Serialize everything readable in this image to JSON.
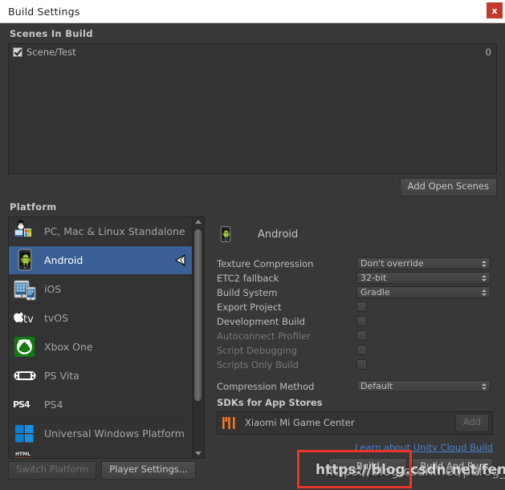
{
  "window": {
    "title": "Build Settings",
    "close_label": "x"
  },
  "scenes_section": {
    "header": "Scenes In Build",
    "rows": [
      {
        "name": "Scene/Test",
        "index": "0",
        "checked": true
      }
    ],
    "add_open_scenes_label": "Add Open Scenes"
  },
  "platform_section": {
    "header": "Platform",
    "items": [
      {
        "label": "PC, Mac & Linux Standalone",
        "icon": "standalone-icon",
        "selected": false
      },
      {
        "label": "Android",
        "icon": "android-icon",
        "selected": true
      },
      {
        "label": "iOS",
        "icon": "ios-icon",
        "selected": false
      },
      {
        "label": "tvOS",
        "icon": "tvos-icon",
        "selected": false
      },
      {
        "label": "Xbox One",
        "icon": "xbox-icon",
        "selected": false
      },
      {
        "label": "PS Vita",
        "icon": "psvita-icon",
        "selected": false
      },
      {
        "label": "PS4",
        "icon": "ps4-icon",
        "selected": false
      },
      {
        "label": "Universal Windows Platform",
        "icon": "windows-icon",
        "selected": false
      },
      {
        "label": "",
        "icon": "webgl-icon",
        "selected": false
      }
    ]
  },
  "settings_panel": {
    "platform_title": "Android",
    "dropdowns": [
      {
        "label": "Texture Compression",
        "value": "Don't override"
      },
      {
        "label": "ETC2 fallback",
        "value": "32-bit"
      },
      {
        "label": "Build System",
        "value": "Gradle"
      }
    ],
    "checkboxes": [
      {
        "label": "Export Project",
        "checked": false,
        "disabled": false
      },
      {
        "label": "Development Build",
        "checked": false,
        "disabled": false
      },
      {
        "label": "Autoconnect Profiler",
        "checked": false,
        "disabled": true
      },
      {
        "label": "Script Debugging",
        "checked": false,
        "disabled": true
      },
      {
        "label": "Scripts Only Build",
        "checked": false,
        "disabled": true
      }
    ],
    "compression": {
      "label": "Compression Method",
      "value": "Default"
    },
    "sdk_header": "SDKs for App Stores",
    "sdk_row": {
      "name": "Xiaomi Mi Game Center",
      "add_label": "Add",
      "logo_color": "#F47920"
    },
    "cloud_link": "Learn about Unity Cloud Build",
    "build_label": "Build",
    "build_and_run_label": "Build And Run"
  },
  "footer": {
    "switch_platform_label": "Switch Platform",
    "player_settings_label": "Player Settings..."
  },
  "annotation": {
    "watermark_text": "https://blog.csdn.net/feng_N",
    "watermark_text_2": "https://blog.csdn.net/perog_Naaa",
    "highlight_color": "#e8352a"
  }
}
